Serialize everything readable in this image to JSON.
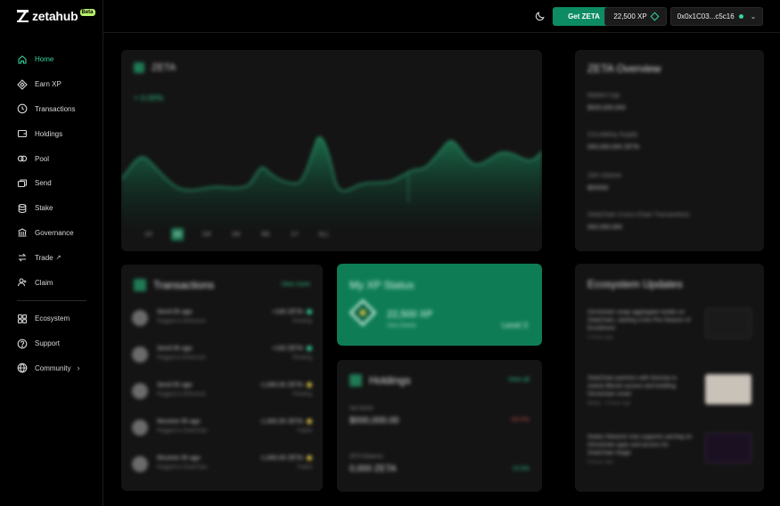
{
  "app": {
    "logo_text": "zetahub",
    "beta_badge": "Beta"
  },
  "sidebar": {
    "items": [
      {
        "label": "Home",
        "icon": "home-icon",
        "active": true
      },
      {
        "label": "Earn XP",
        "icon": "diamond-icon"
      },
      {
        "label": "Transactions",
        "icon": "clock-icon"
      },
      {
        "label": "Holdings",
        "icon": "wallet-icon"
      },
      {
        "label": "Pool",
        "icon": "pool-icon"
      },
      {
        "label": "Send",
        "icon": "send-icon"
      },
      {
        "label": "Stake",
        "icon": "coins-icon"
      },
      {
        "label": "Governance",
        "icon": "bank-icon"
      },
      {
        "label": "Trade",
        "icon": "trade-icon",
        "external": true
      },
      {
        "label": "Claim",
        "icon": "user-plus-icon"
      }
    ],
    "secondary": [
      {
        "label": "Ecosystem",
        "icon": "grid-icon"
      },
      {
        "label": "Support",
        "icon": "help-icon"
      },
      {
        "label": "Community",
        "icon": "globe-icon",
        "has_submenu": true
      }
    ]
  },
  "header": {
    "theme_icon": "moon-icon",
    "get_zeta_label": "Get ZETA",
    "xp_label": "22,500 XP",
    "wallet_label": "0x0x1C03...c5c16",
    "wallet_status_color": "#37d39a"
  },
  "colors": {
    "accent": "#37d39a",
    "brand_green": "#0d8c64",
    "panel": "#141414"
  },
  "price_panel": {
    "token": "ZETA",
    "change": "+ 0.00%",
    "ranges": [
      "1H",
      "1D",
      "1W",
      "1M",
      "3M",
      "1Y",
      "ALL"
    ],
    "selected_range": "1D"
  },
  "overview": {
    "title": "ZETA Overview",
    "rows": [
      {
        "label": "Market Cap",
        "value": "$000,000,000"
      },
      {
        "label": "Circulating Supply",
        "value": "000,000,000 ZETA"
      },
      {
        "label": "24H Volume",
        "value": "$00000"
      },
      {
        "label": "ZetaChain Cross-Chain Transactions",
        "value": "000,000,000"
      }
    ]
  },
  "transactions": {
    "title": "Transactions",
    "view_all": "View more",
    "rows": [
      {
        "title": "Send 0h ago",
        "sub": "Pegged to Ethereum",
        "amount": "+100 ZETA",
        "status": "Pending",
        "status_color": "#37d39a"
      },
      {
        "title": "Send 0h ago",
        "sub": "Pegged to Ethereum",
        "amount": "+100 ZETA",
        "status": "Pending",
        "status_color": "#37d39a"
      },
      {
        "title": "Send 0h ago",
        "sub": "Pegged to Ethereum",
        "amount": "-1,000.00 ZETA",
        "status": "Pending",
        "status_color": "#d9c04b"
      },
      {
        "title": "Receive 0h ago",
        "sub": "Pegged to ZetaChain",
        "amount": "-1,000.00 ZETA",
        "status": "Failed",
        "status_color": "#d9c04b"
      },
      {
        "title": "Receive 0h ago",
        "sub": "Pegged to ZetaChain",
        "amount": "-1,000.00 ZETA",
        "status": "Failed",
        "status_color": "#d9c04b"
      }
    ]
  },
  "xp_status": {
    "title": "My XP Status",
    "value": "22,500 XP",
    "sub": "View Details",
    "level": "Level 3"
  },
  "holdings": {
    "title": "Holdings",
    "view_all": "View all",
    "rows": [
      {
        "label": "Net Worth",
        "value": "$000,000.00",
        "delta": "-00.0%",
        "delta_color": "#c0524b"
      },
      {
        "label": "ZETA Balance",
        "value": "0,000 ZETA",
        "delta": "+0.0%",
        "delta_color": "#2ec58a"
      }
    ]
  },
  "ecosystem": {
    "title": "Ecosystem Updates",
    "items": [
      {
        "text": "Omnichain swap aggregator builds on ZetaChain, starting a live Pre-Season of Enrollment",
        "meta": "0 hours ago",
        "thumb_color": "#1a1a1a"
      },
      {
        "text": "ZetaChain partners with Nomoly to unlock Bitcoin access and building Omnichain smart",
        "meta": "Media · 0 hours ago",
        "thumb_color": "#c9c2b9"
      },
      {
        "text": "Nodes Network now supports earning on Omnichain apps and access for ZetaChain Stage",
        "meta": "0 hours ago",
        "thumb_color": "#1b0f22"
      }
    ]
  }
}
